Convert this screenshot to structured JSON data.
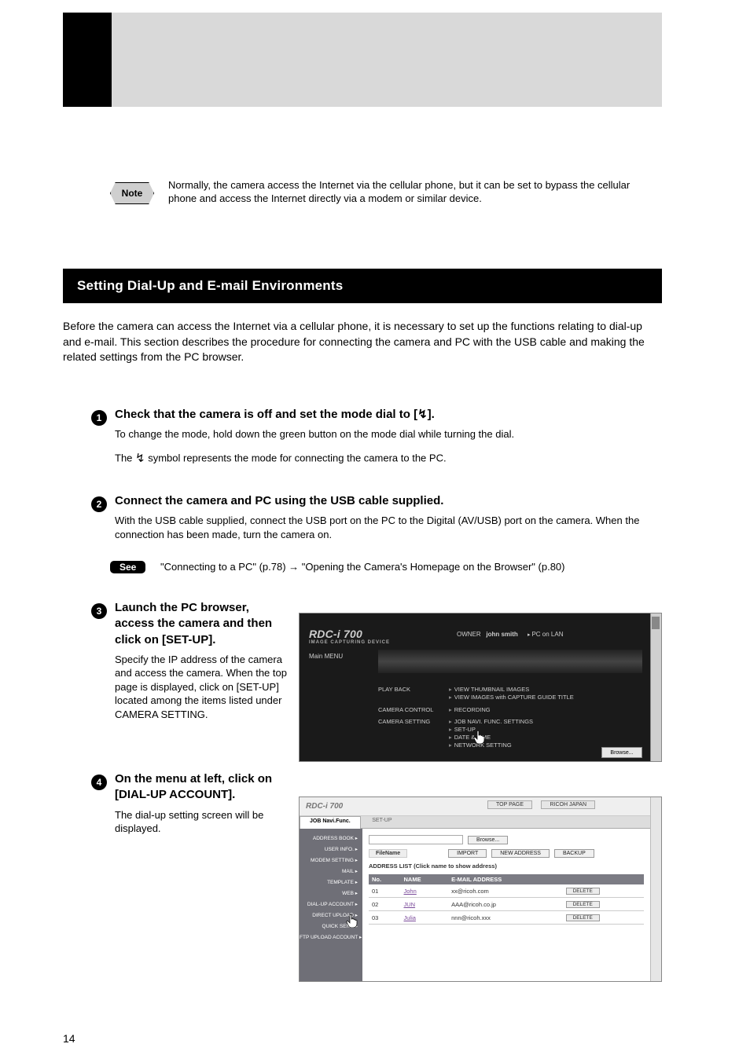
{
  "page_number": "14",
  "note_label": "Note",
  "note_text": "Normally, the camera access the Internet via the cellular phone, but it can be set to bypass the cellular phone and access the Internet directly via a modem or similar device.",
  "section_title": "Setting Dial-Up and E-mail Environments",
  "intro_text": "Before the camera can access the Internet via a cellular phone, it is necessary to set up the functions relating to dial-up and e-mail. This section describes the procedure for connecting the camera and PC with the USB cable and making the related settings from the PC browser.",
  "steps": [
    {
      "num": "1",
      "title": "Check that the camera is off and set the mode dial to [ ].",
      "body": "To change the mode, hold down the green button on the mode dial while turning the dial. The ⎖ symbol represents the mode for connecting the camera to the PC."
    },
    {
      "num": "2",
      "title": "Connect the camera and PC using the USB cable supplied.",
      "body": "With the USB cable supplied, connect the USB port on the PC to the Digital (AV/USB) port on the camera. When the connection has been made, turn the camera on."
    },
    {
      "num": "3",
      "title": "Launch the PC browser, access the camera and then click on [SET-UP].",
      "body": "Specify the IP address of the camera and access the camera. When the top page is displayed, click on [SET-UP] located among the items listed under CAMERA SETTING."
    },
    {
      "num": "4",
      "title": "On the menu at left, click on [DIAL-UP ACCOUNT].",
      "body": "The dial-up setting screen will be displayed."
    }
  ],
  "see_label": "See",
  "see_text": "\"Connecting to a PC\" (p.78) → \"Opening the Camera's Homepage on the Browser\" (p.80)",
  "screenshot1": {
    "logo": "RDC-i 700",
    "logo_sub": "IMAGE CAPTURING DEVICE",
    "owner_label": "OWNER",
    "owner_name": "john smith",
    "pc_mode": "PC on LAN",
    "main_menu": "Main MENU",
    "browse_btn": "Browse...",
    "rows": [
      {
        "label": "PLAY BACK",
        "items": [
          "VIEW THUMBNAIL IMAGES",
          "VIEW IMAGES with CAPTURE GUIDE TITLE"
        ]
      },
      {
        "label": "CAMERA CONTROL",
        "items": [
          "RECORDING"
        ]
      },
      {
        "label": "CAMERA SETTING",
        "items": [
          "JOB NAVI. FUNC. SETTINGS",
          "SET-UP",
          "DATE & TIME",
          "NETWORK SETTING"
        ]
      }
    ]
  },
  "screenshot2": {
    "logo": "RDC-i 700",
    "top_page": "TOP PAGE",
    "ricoh_japan": "RICOH JAPAN",
    "tabs": {
      "active": "JOB Navi.Func.",
      "inactive": "SET-UP"
    },
    "sidebar": [
      "ADDRESS BOOK",
      "USER INFO.",
      "MODEM SETTING",
      "MAIL",
      "TEMPLATE",
      "WEB",
      "DIAL-UP ACCOUNT",
      "DIRECT UPLOAD",
      "QUICK SEND",
      "FTP UPLOAD ACCOUNT"
    ],
    "file_label": "FileName",
    "browse": "Browse...",
    "import": "IMPORT",
    "new_address": "NEW ADDRESS",
    "backup": "BACKUP",
    "list_title": "ADDRESS LIST (Click name to show address)",
    "columns": [
      "No.",
      "NAME",
      "E-MAIL ADDRESS",
      ""
    ],
    "rows": [
      {
        "no": "01",
        "name": "John",
        "email": "xx@ricoh.com"
      },
      {
        "no": "02",
        "name": "JUN",
        "email": "AAA@ricoh.co.jp"
      },
      {
        "no": "03",
        "name": "Julia",
        "email": "nnn@ricoh.xxx"
      }
    ],
    "delete": "DELETE"
  }
}
